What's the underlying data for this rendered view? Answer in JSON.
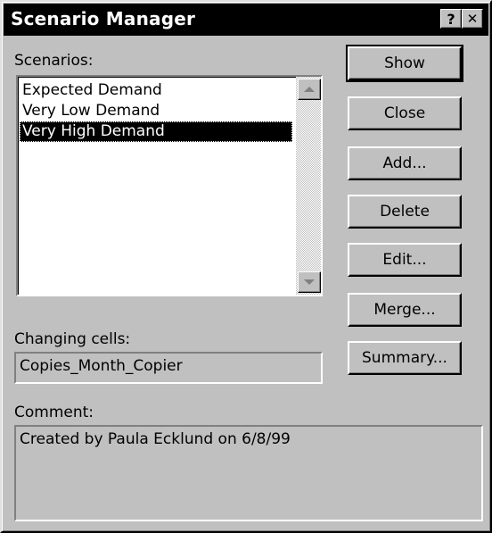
{
  "window": {
    "title": "Scenario Manager",
    "help_glyph": "?",
    "close_glyph": "✕"
  },
  "scenarios": {
    "label": "Scenarios:",
    "items": [
      "Expected Demand",
      "Very Low Demand",
      "Very High Demand"
    ],
    "selected_index": 2
  },
  "changing_cells": {
    "label": "Changing cells:",
    "value": "Copies_Month_Copier"
  },
  "comment": {
    "label": "Comment:",
    "value": "Created by Paula Ecklund on 6/8/99"
  },
  "buttons": {
    "show": "Show",
    "close": "Close",
    "add": "Add...",
    "delete": "Delete",
    "edit": "Edit...",
    "merge": "Merge...",
    "summary": "Summary..."
  },
  "icons": {
    "scroll_up": "scroll-up-arrow-icon",
    "scroll_down": "scroll-down-arrow-icon"
  }
}
